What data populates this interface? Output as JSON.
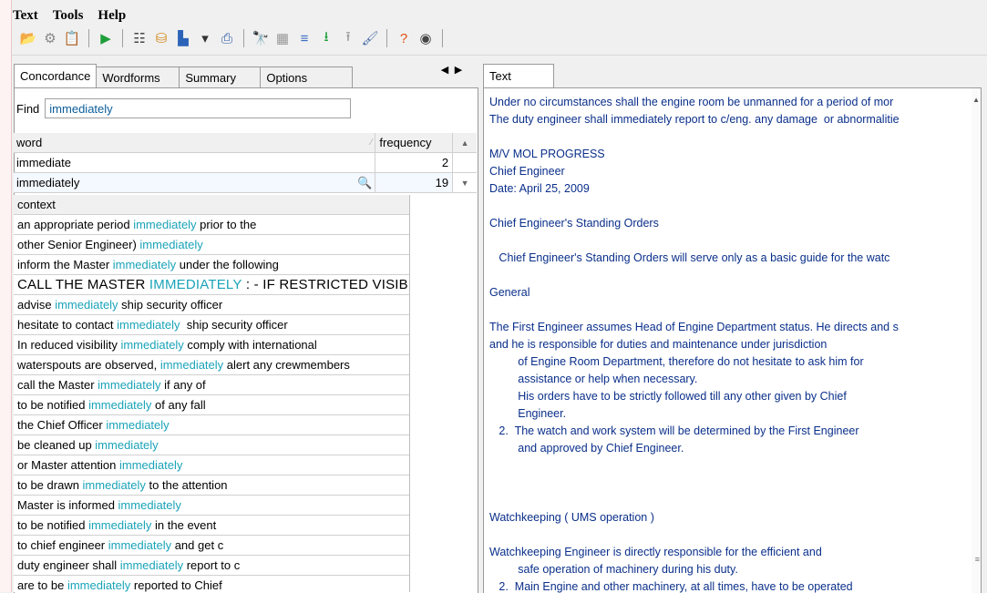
{
  "menu": [
    "Text",
    "Tools",
    "Help"
  ],
  "toolbar": [
    {
      "icon": "open-folder-icon",
      "glyph": "📂",
      "color": "#2a5aa8"
    },
    {
      "icon": "gears-icon",
      "glyph": "⚙",
      "color": "#888888"
    },
    {
      "icon": "clipboard-icon",
      "glyph": "📋",
      "color": "#777777"
    },
    {
      "sep": true
    },
    {
      "icon": "play-icon",
      "glyph": "▶",
      "color": "#1e9e3a"
    },
    {
      "sep": true
    },
    {
      "icon": "list-icon",
      "glyph": "☷",
      "color": "#444444"
    },
    {
      "icon": "database-icon",
      "glyph": "⛁",
      "color": "#d38a1e"
    },
    {
      "icon": "bar-chart-icon",
      "glyph": "▙",
      "color": "#2b63b8"
    },
    {
      "icon": "dropdown-arrow-icon",
      "glyph": "▾",
      "color": "#333333"
    },
    {
      "icon": "print-icon",
      "glyph": "⎙",
      "color": "#2a5aa8"
    },
    {
      "sep": true
    },
    {
      "icon": "binoculars-icon",
      "glyph": "🔭",
      "color": "#333333"
    },
    {
      "icon": "copy-icon",
      "glyph": "▦",
      "color": "#999999"
    },
    {
      "icon": "align-icon",
      "glyph": "≡",
      "color": "#3a6cc0"
    },
    {
      "icon": "sort-down-icon",
      "glyph": "⭳",
      "color": "#1e9e3a"
    },
    {
      "icon": "sort-up-icon",
      "glyph": "⭱",
      "color": "#999999"
    },
    {
      "icon": "brush-icon",
      "glyph": "🖌",
      "color": "#4d6ea8"
    },
    {
      "sep": true
    },
    {
      "icon": "help-icon",
      "glyph": "?",
      "color": "#e05010"
    },
    {
      "icon": "about-icon",
      "glyph": "◉",
      "color": "#444444"
    },
    {
      "sep": true
    }
  ],
  "left_tabs": [
    "Concordance",
    "Wordforms",
    "Summary",
    "Options"
  ],
  "right_tabs": [
    "Text"
  ],
  "find": {
    "label": "Find",
    "value": "immediately"
  },
  "wordforms": {
    "headers": {
      "word": "word",
      "frequency": "frequency"
    },
    "rows": [
      {
        "word": "immediate",
        "frequency": "2"
      },
      {
        "word": "immediately",
        "frequency": "19"
      }
    ]
  },
  "context": {
    "header": "context",
    "rows": [
      {
        "pre": "an appropriate period ",
        "hit": "immediately",
        "post": " prior to the"
      },
      {
        "pre": "other Senior Engineer) ",
        "hit": "immediately",
        "post": ""
      },
      {
        "pre": "inform the Master ",
        "hit": "immediately",
        "post": " under the following"
      },
      {
        "pre": "CALL THE MASTER ",
        "hit": "IMMEDIATELY",
        "post": " : - IF RESTRICTED VISIBIL"
      },
      {
        "pre": "advise ",
        "hit": "immediately",
        "post": " ship security officer"
      },
      {
        "pre": "hesitate to contact ",
        "hit": "immediately",
        "post": "  ship security officer"
      },
      {
        "pre": "In reduced visibility ",
        "hit": "immediately",
        "post": " comply with international"
      },
      {
        "pre": "waterspouts are observed, ",
        "hit": "immediately",
        "post": " alert any crewmembers"
      },
      {
        "pre": "call the Master ",
        "hit": "immediately",
        "post": " if any of"
      },
      {
        "pre": "to be notified ",
        "hit": "immediately",
        "post": " of any fall"
      },
      {
        "pre": "the Chief Officer ",
        "hit": "immediately",
        "post": ""
      },
      {
        "pre": "be cleaned up ",
        "hit": "immediately",
        "post": ""
      },
      {
        "pre": "or Master attention ",
        "hit": "immediately",
        "post": ""
      },
      {
        "pre": "to be drawn ",
        "hit": "immediately",
        "post": " to the attention"
      },
      {
        "pre": "Master is informed ",
        "hit": "immediately",
        "post": ""
      },
      {
        "pre": "to be notified ",
        "hit": "immediately",
        "post": " in the event"
      },
      {
        "pre": "to chief engineer ",
        "hit": "immediately",
        "post": " and get c"
      },
      {
        "pre": "duty engineer shall ",
        "hit": "immediately",
        "post": " report to c"
      },
      {
        "pre": "are to be ",
        "hit": "immediately",
        "post": " reported to Chief"
      }
    ]
  },
  "text_lines": [
    "Under no circumstances shall the engine room be unmanned for a period of mor",
    "The duty engineer shall immediately report to c/eng. any damage  or abnormalitie",
    "",
    "M/V MOL PROGRESS",
    "Chief Engineer",
    "Date: April 25, 2009",
    "",
    "Chief Engineer's Standing Orders",
    "",
    "   Chief Engineer's Standing Orders will serve only as a basic guide for the watc",
    "",
    "General",
    "",
    "The First Engineer assumes Head of Engine Department status. He directs and s",
    "and he is responsible for duties and maintenance under jurisdiction",
    "         of Engine Room Department, therefore do not hesitate to ask him for",
    "         assistance or help when necessary.",
    "         His orders have to be strictly followed till any other given by Chief",
    "         Engineer.",
    "   2.  The watch and work system will be determined by the First Engineer",
    "         and approved by Chief Engineer.",
    "",
    "",
    "",
    "Watchkeeping ( UMS operation )",
    "",
    "Watchkeeping Engineer is directly responsible for the efficient and",
    "         safe operation of machinery during his duty.",
    "   2.  Main Engine and other machinery, at all times, have to be operated"
  ],
  "colors": {
    "hit": "#1aa3b8",
    "find_text": "#0a5d9a",
    "text_color": "#0a2f8a"
  }
}
